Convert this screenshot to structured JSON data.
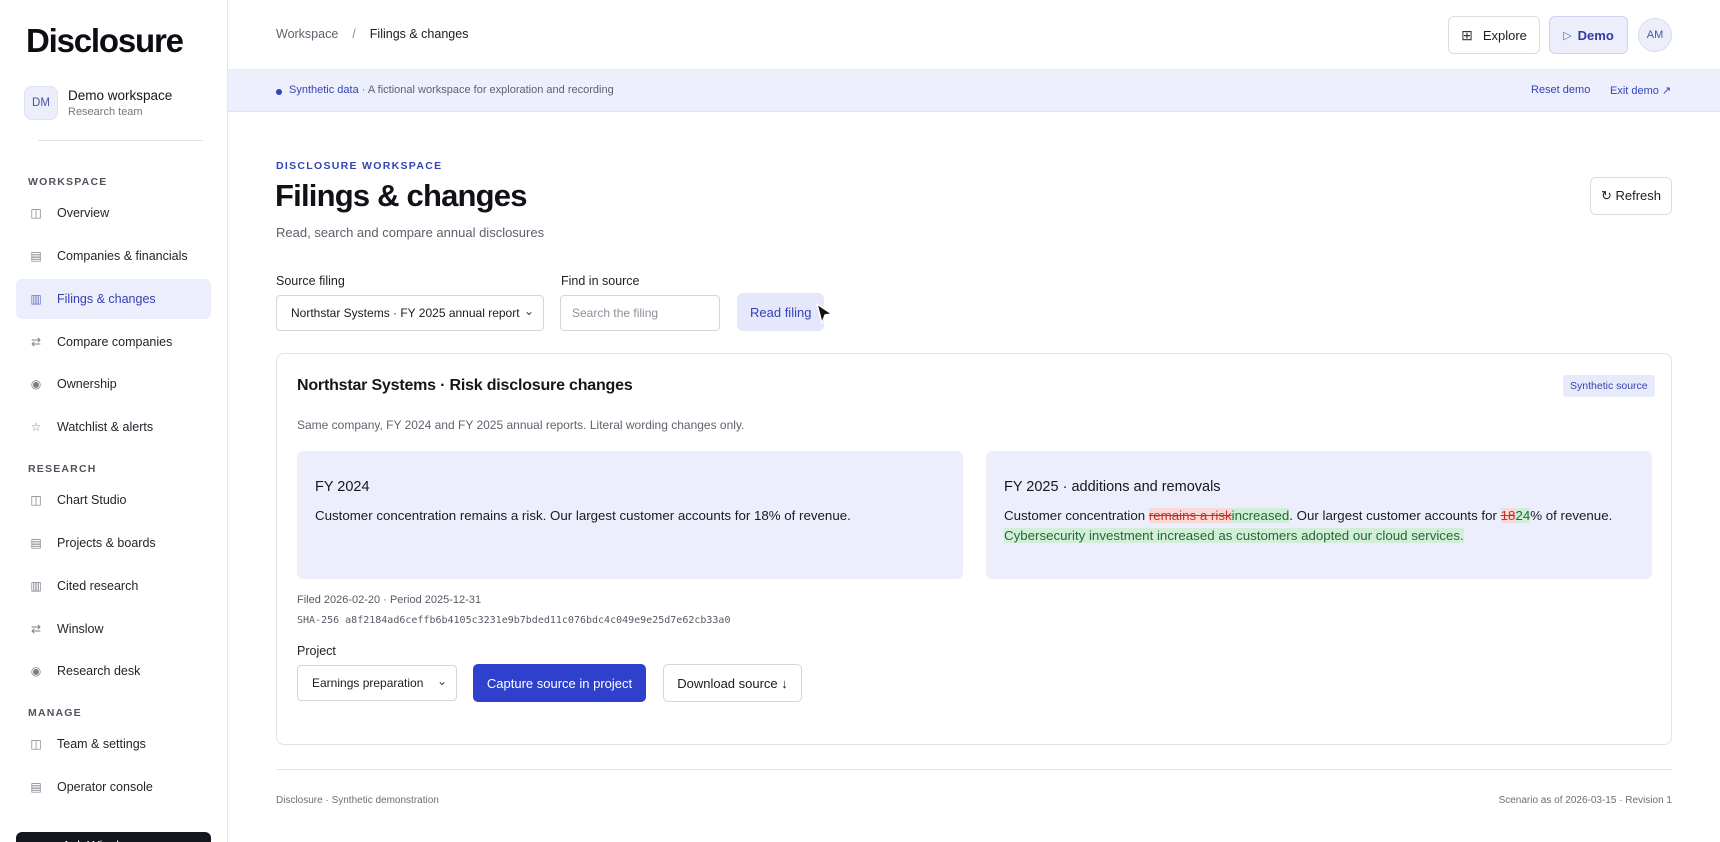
{
  "sidebar": {
    "brand": "Disclosure",
    "workspace": {
      "initials": "DM",
      "name": "Demo workspace",
      "team": "Research team"
    },
    "sections": {
      "workspace": "WORKSPACE",
      "research": "RESEARCH",
      "manage": "MANAGE"
    },
    "items": [
      {
        "label": "Overview",
        "icon": "grid-icon",
        "glyph": "◫"
      },
      {
        "label": "Companies & financials",
        "icon": "table-icon",
        "glyph": "▤"
      },
      {
        "label": "Filings & changes",
        "icon": "columns-icon",
        "glyph": "▥",
        "active": true
      },
      {
        "label": "Compare companies",
        "icon": "swap-icon",
        "glyph": "⇄"
      },
      {
        "label": "Ownership",
        "icon": "circle-dot-icon",
        "glyph": "◉"
      },
      {
        "label": "Watchlist & alerts",
        "icon": "star-icon",
        "glyph": "☆"
      },
      {
        "label": "Chart Studio",
        "icon": "grid-icon",
        "glyph": "◫"
      },
      {
        "label": "Projects & boards",
        "icon": "table-icon",
        "glyph": "▤"
      },
      {
        "label": "Cited research",
        "icon": "columns-icon",
        "glyph": "▥"
      },
      {
        "label": "Winslow",
        "icon": "swap-icon",
        "glyph": "⇄"
      },
      {
        "label": "Research desk",
        "icon": "circle-dot-icon",
        "glyph": "◉"
      },
      {
        "label": "Team & settings",
        "icon": "grid-icon",
        "glyph": "◫"
      },
      {
        "label": "Operator console",
        "icon": "table-icon",
        "glyph": "▤"
      }
    ],
    "ask_label": "Ask Winslow"
  },
  "topbar": {
    "breadcrumb": [
      "Workspace",
      "Filings & changes"
    ],
    "breadcrumb_sep": "/",
    "explore_label": "Explore",
    "explore_icon": "⊞",
    "demo_label": "Demo",
    "demo_icon": "▷",
    "user_initials": "AM"
  },
  "banner": {
    "highlight": "Synthetic data",
    "text": " · A fictional workspace for exploration and recording",
    "reset": "Reset demo",
    "exit": "Exit demo ↗"
  },
  "page": {
    "eyebrow": "DISCLOSURE WORKSPACE",
    "title": "Filings & changes",
    "subtitle": "Read, search and compare annual disclosures",
    "refresh": "↻ Refresh"
  },
  "form": {
    "source_label": "Source filing",
    "source_value": "Northstar Systems · FY 2025 annual report",
    "find_label": "Find in source",
    "find_placeholder": "Search the filing",
    "find_value": "",
    "read_button": "Read filing"
  },
  "card": {
    "title": "Northstar Systems · Risk disclosure changes",
    "tag": "Synthetic source",
    "subtitle": "Same company, FY 2024 and FY 2025 annual reports. Literal wording changes only.",
    "left": {
      "heading": "FY 2024",
      "body": "Customer concentration remains a risk. Our largest customer accounts for 18% of revenue."
    },
    "right": {
      "heading": "FY 2025 · additions and removals",
      "p1": "Customer concentration ",
      "del1": "remains a risk",
      "ins1": "increased",
      "p2": ". Our largest customer accounts for ",
      "del2": "18",
      "ins2": "24",
      "p3": "% of revenue.",
      "ins3": "Cybersecurity investment increased as customers adopted our cloud services."
    },
    "filed": "Filed 2026-02-20 · Period 2025-12-31",
    "sha": "SHA-256 a8f2184ad6ceffb6b4105c3231e9b7bded11c076bdc4c049e9e25d7e62cb33a0",
    "project_label": "Project",
    "project_value": "Earnings preparation",
    "capture_button": "Capture source in project",
    "download_button": "Download source ↓"
  },
  "footer": {
    "left": "Disclosure · Synthetic demonstration",
    "right": "Scenario as of 2026-03-15 · Revision 1"
  },
  "colors": {
    "accent": "#2e40cc",
    "accent_soft": "#eceefb",
    "removed": "#c2322b",
    "added": "#1e6b33"
  }
}
